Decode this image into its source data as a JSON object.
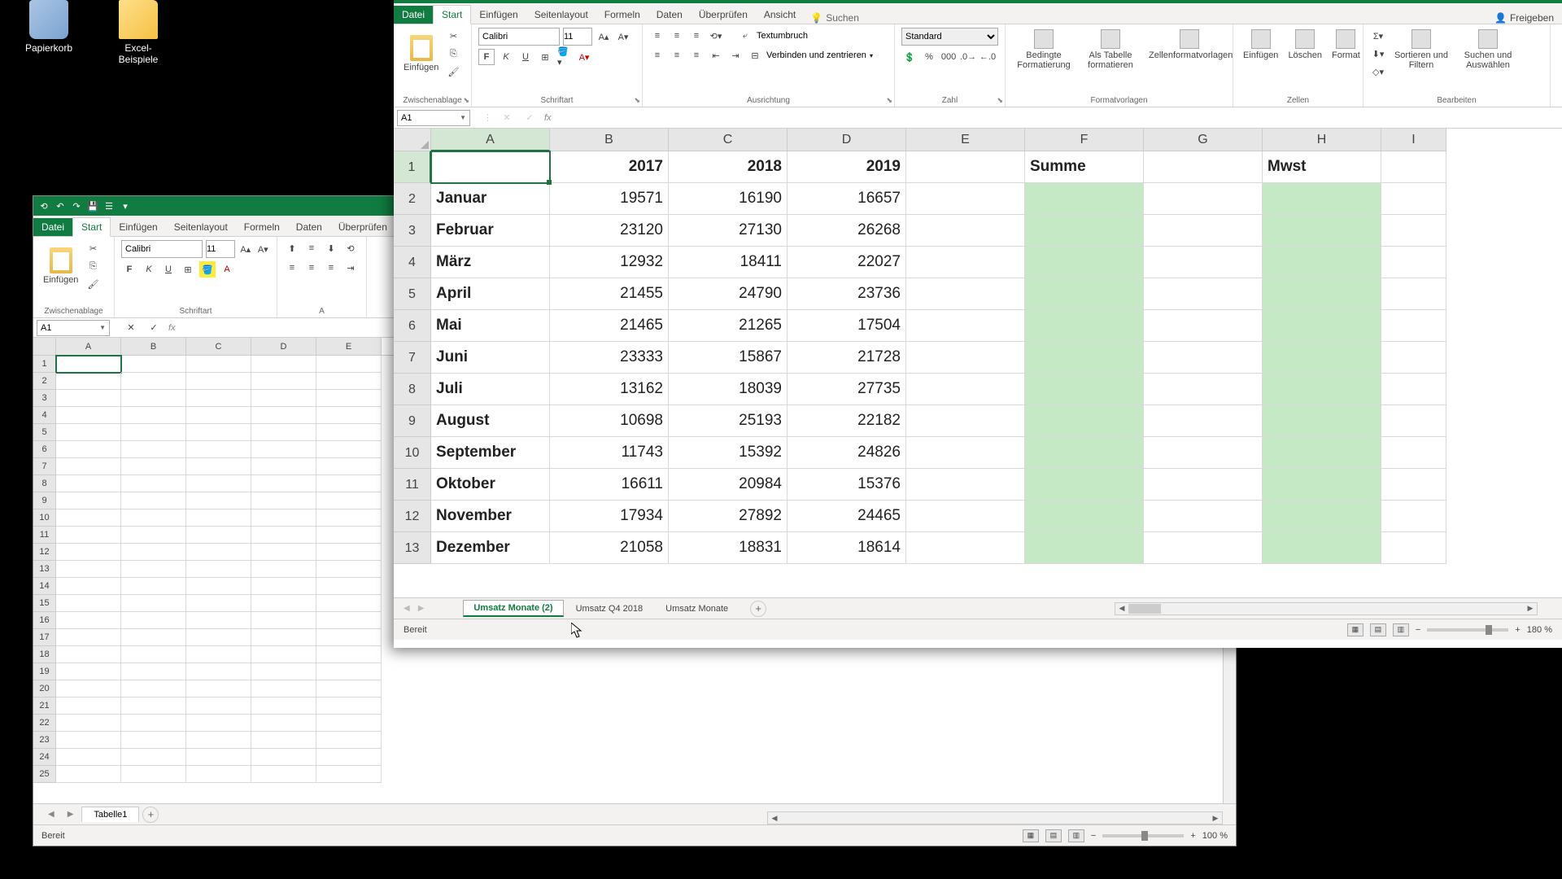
{
  "desktop": {
    "recycle_bin": "Papierkorb",
    "folder": "Excel-Beispiele"
  },
  "back_window": {
    "tabs": {
      "file": "Datei",
      "start": "Start",
      "einfuegen": "Einfügen",
      "seitenlayout": "Seitenlayout",
      "formeln": "Formeln",
      "daten": "Daten",
      "ueberpruefen": "Überprüfen"
    },
    "ribbon": {
      "clipboard_label": "Zwischenablage",
      "font_label": "Schriftart",
      "paste": "Einfügen",
      "font_name": "Calibri",
      "font_size": "11"
    },
    "namebox": "A1",
    "cols": [
      "A",
      "B",
      "C",
      "D",
      "E"
    ],
    "rows": [
      "1",
      "2",
      "3",
      "4",
      "5",
      "6",
      "7",
      "8",
      "9",
      "10",
      "11",
      "12",
      "13",
      "14",
      "15",
      "16",
      "17",
      "18",
      "19",
      "20",
      "21",
      "22",
      "23",
      "24",
      "25"
    ],
    "sheet_tab": "Tabelle1",
    "status": "Bereit",
    "zoom": "100 %"
  },
  "front_window": {
    "tabs": {
      "file": "Datei",
      "start": "Start",
      "einfuegen": "Einfügen",
      "seitenlayout": "Seitenlayout",
      "formeln": "Formeln",
      "daten": "Daten",
      "ueberpruefen": "Überprüfen",
      "ansicht": "Ansicht"
    },
    "search": "Suchen",
    "share": "Freigeben",
    "ribbon": {
      "clipboard_label": "Zwischenablage",
      "font_label": "Schriftart",
      "alignment_label": "Ausrichtung",
      "number_label": "Zahl",
      "styles_label": "Formatvorlagen",
      "cells_label": "Zellen",
      "editing_label": "Bearbeiten",
      "paste": "Einfügen",
      "font_name": "Calibri",
      "font_size": "11",
      "wrap": "Textumbruch",
      "merge": "Verbinden und zentrieren",
      "numfmt": "Standard",
      "cond_fmt": "Bedingte Formatierung",
      "as_table": "Als Tabelle formatieren",
      "cell_styles": "Zellenformatvorlagen",
      "insert": "Einfügen",
      "delete": "Löschen",
      "format": "Format",
      "sort": "Sortieren und Filtern",
      "find": "Suchen und Auswählen"
    },
    "namebox": "A1",
    "cols": [
      "A",
      "B",
      "C",
      "D",
      "E",
      "F",
      "G",
      "H",
      "I"
    ],
    "headers": {
      "b": "2017",
      "c": "2018",
      "d": "2019",
      "f": "Summe",
      "h": "Mwst"
    },
    "rows": [
      {
        "n": "1"
      },
      {
        "n": "2",
        "a": "Januar",
        "b": "19571",
        "c": "16190",
        "d": "16657"
      },
      {
        "n": "3",
        "a": "Februar",
        "b": "23120",
        "c": "27130",
        "d": "26268"
      },
      {
        "n": "4",
        "a": "März",
        "b": "12932",
        "c": "18411",
        "d": "22027"
      },
      {
        "n": "5",
        "a": "April",
        "b": "21455",
        "c": "24790",
        "d": "23736"
      },
      {
        "n": "6",
        "a": "Mai",
        "b": "21465",
        "c": "21265",
        "d": "17504"
      },
      {
        "n": "7",
        "a": "Juni",
        "b": "23333",
        "c": "15867",
        "d": "21728"
      },
      {
        "n": "8",
        "a": "Juli",
        "b": "13162",
        "c": "18039",
        "d": "27735"
      },
      {
        "n": "9",
        "a": "August",
        "b": "10698",
        "c": "25193",
        "d": "22182"
      },
      {
        "n": "10",
        "a": "September",
        "b": "11743",
        "c": "15392",
        "d": "24826"
      },
      {
        "n": "11",
        "a": "Oktober",
        "b": "16611",
        "c": "20984",
        "d": "15376"
      },
      {
        "n": "12",
        "a": "November",
        "b": "17934",
        "c": "27892",
        "d": "24465"
      },
      {
        "n": "13",
        "a": "Dezember",
        "b": "21058",
        "c": "18831",
        "d": "18614"
      }
    ],
    "sheets": [
      "Umsatz Monate (2)",
      "Umsatz Q4 2018",
      "Umsatz Monate"
    ],
    "status": "Bereit",
    "zoom": "180 %"
  }
}
